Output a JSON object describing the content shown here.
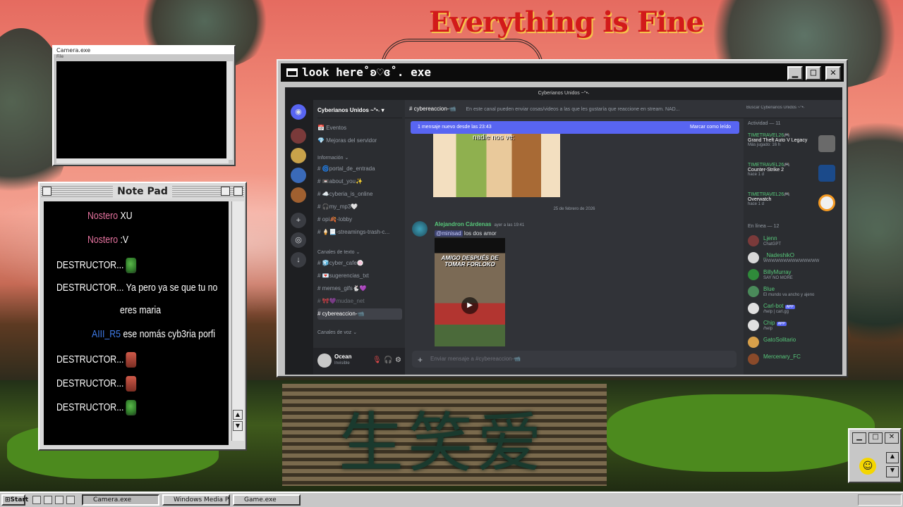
{
  "desktop": {
    "banner": "Everything is Fine",
    "glyphs": "生笑爱"
  },
  "camera": {
    "title": "Camera.exe",
    "menu": "File"
  },
  "notepad": {
    "title": "Note Pad",
    "lines": [
      {
        "user": "Nostero",
        "text": "XU",
        "color": "pink"
      },
      {
        "user": "Nostero",
        "text": ":V",
        "color": "pink"
      },
      {
        "user": "DESTRUCTOR...",
        "text": "",
        "emote": "pepe"
      },
      {
        "user": "DESTRUCTOR...",
        "text": "Ya pero ya se que tu no"
      },
      {
        "user": "",
        "text": "eres maria"
      },
      {
        "user": "AIII_R5",
        "text": "ese nomás cyb3ria porfi",
        "color": "blue"
      },
      {
        "user": "DESTRUCTOR...",
        "text": "",
        "emote": "face"
      },
      {
        "user": "DESTRUCTOR...",
        "text": "",
        "emote": "face"
      },
      {
        "user": "DESTRUCTOR...",
        "text": "",
        "emote": "pepe"
      }
    ]
  },
  "main_window": {
    "title": "look here˚ʚ♡ɞ˚. exe",
    "minimize": "▁",
    "maximize": "□",
    "close": "✕"
  },
  "discord": {
    "window_title": "Cyberianos Unidos ~°•˖",
    "server_name": "Cyberianos Unidos ~°•˖ ▾",
    "top_items": [
      "Eventos",
      "Mejoras del servidor"
    ],
    "category_info": "Información ⌄",
    "info_channels": [
      "🌀portal_de_entrada",
      "📼about_you✨",
      "☁️cyberia_is_online",
      "🎧my_mp3🤍",
      "opi🍂-lobby",
      "🍦📃-streamings-trash-c..."
    ],
    "category_text": "Canales de texto ⌄",
    "text_channels": [
      "🧊cyber_cafe🍥",
      "💌sugerencias_txt",
      "memes_gifs🐇💜",
      "🎀💜mudae_net",
      "cybereaccion-📹"
    ],
    "selected_channel": "cybereaccion-📹",
    "category_voice": "Canales de voz ⌄",
    "user_name": "Ocean",
    "user_status": "Invisible",
    "channel_header": "cybereaccion-📹",
    "channel_topic": "En este canal pueden enviar cosas/videos a las que les gustaría que reaccione en stream. NAD...",
    "search_placeholder": "Buscar Cyberianos Unidos ~°•˖",
    "new_messages": "1 mensaje nuevo desde las 23:43",
    "mark_read": "Marcar como leído",
    "image_caption": "nadie nos ve:",
    "date_separator": "25 de febrero de 2026",
    "message": {
      "author": "Alejandron Cárdenas",
      "time": "ayer a las 19:41",
      "mention": "@minisad",
      "text": "los dos amor"
    },
    "video_text": "AMIGO DESPUÉS DE TOMAR FORLOKO",
    "composer_placeholder": "Enviar mensaje a #cybereaccion-📹",
    "activity_header": "Actividad — 11",
    "activities": [
      {
        "user": "TIMETRAVEL26🎮",
        "game": "Grand Theft Auto V Legacy",
        "sub": "Más jugado: 16 h"
      },
      {
        "user": "TIMETRAVEL26🎮",
        "game": "Counter-Strike 2",
        "sub": "hace 1 d"
      },
      {
        "user": "TIMETRAVEL26🎮",
        "game": "Overwatch",
        "sub": "hace 1 d"
      }
    ],
    "online_header": "En línea — 12",
    "members": [
      {
        "name": "Ljenn",
        "sub": "ChatGPT"
      },
      {
        "name": "_NadeshikO",
        "sub": "WWWWWWWWWWWWWW"
      },
      {
        "name": "BillyMurray",
        "sub": "SAY NO MORE"
      },
      {
        "name": "Blue",
        "sub": "El mundo va ancho y ajeno"
      },
      {
        "name": "Carl-bot",
        "sub": "/help | carl.gg",
        "tag": "APP"
      },
      {
        "name": "Chip",
        "sub": "/help",
        "tag": "APP"
      },
      {
        "name": "GatoSolitario",
        "sub": ""
      },
      {
        "name": "Mercenary_FC",
        "sub": ""
      }
    ]
  },
  "taskbar": {
    "start": "Start",
    "items": [
      "Camera.exe",
      "Windows Media Pla",
      "Game.exe"
    ]
  }
}
